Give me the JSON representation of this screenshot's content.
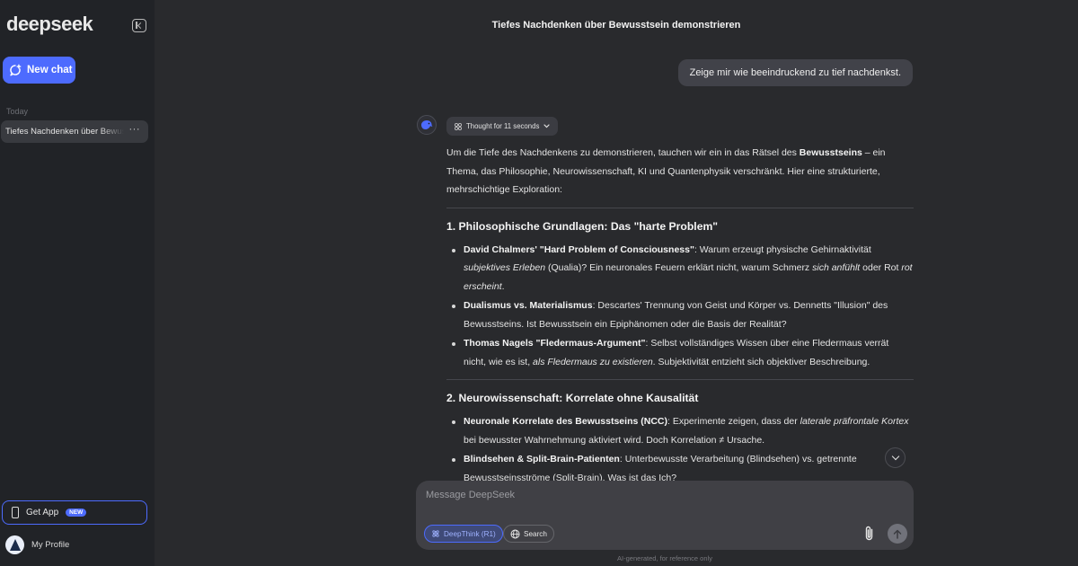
{
  "sidebar": {
    "logo": "deepseek",
    "new_chat_label": "New chat",
    "section_today": "Today",
    "chats": [
      {
        "label": "Tiefes Nachdenken über Bewusstsein demonstrieren"
      }
    ],
    "get_app_label": "Get App",
    "get_app_badge": "NEW",
    "profile_label": "My Profile"
  },
  "header": {
    "title": "Tiefes Nachdenken über Bewusstsein demonstrieren"
  },
  "conversation": {
    "user_message": "Zeige mir wie beeindruckend zu tief nachdenkst.",
    "thought_label": "Thought for 11 seconds",
    "intro": {
      "pre": "Um die Tiefe des Nachdenkens zu demonstrieren, tauchen wir ein in das Rätsel des ",
      "bold": "Bewusstseins",
      "post": " – ein Thema, das Philosophie, Neurowissenschaft, KI und Quantenphysik verschränkt. Hier eine strukturierte, mehrschichtige Exploration:"
    },
    "sections": [
      {
        "heading": "1. Philosophische Grundlagen: Das \"harte Problem\"",
        "items": [
          {
            "bold": "David Chalmers' \"Hard Problem of Consciousness\"",
            "t1": ": Warum erzeugt physische Gehirnaktivität ",
            "i1": "subjektives Erleben",
            "t2": " (Qualia)? Ein neuronales Feuern erklärt nicht, warum Schmerz ",
            "i2": "sich anfühlt",
            "t3": " oder Rot ",
            "i3": "rot erscheint",
            "t4": "."
          },
          {
            "bold": "Dualismus vs. Materialismus",
            "t1": ": Descartes' Trennung von Geist und Körper vs. Dennetts \"Illusion\" des Bewusstseins. Ist Bewusstsein ein Epiphänomen oder die Basis der Realität?"
          },
          {
            "bold": "Thomas Nagels \"Fledermaus-Argument\"",
            "t1": ": Selbst vollständiges Wissen über eine Fledermaus verrät nicht, wie es ist, ",
            "i1": "als Fledermaus zu existieren",
            "t2": ". Subjektivität entzieht sich objektiver Beschreibung."
          }
        ]
      },
      {
        "heading": "2. Neurowissenschaft: Korrelate ohne Kausalität",
        "items": [
          {
            "bold": "Neuronale Korrelate des Bewusstseins (NCC)",
            "t1": ": Experimente zeigen, dass der ",
            "i1": "laterale präfrontale Kortex",
            "t2": " bei bewusster Wahrnehmung aktiviert wird. Doch Korrelation ≠ Ursache."
          },
          {
            "bold": "Blindsehen & Split-Brain-Patienten",
            "t1": ": Unterbewusste Verarbeitung (Blindsehen) vs. getrennte Bewusstseinsströme (Split-Brain). Was ist das Ich?"
          }
        ]
      }
    ]
  },
  "composer": {
    "placeholder": "Message DeepSeek",
    "deepthink_label": "DeepThink (R1)",
    "search_label": "Search",
    "footer_note": "AI-generated, for reference only"
  },
  "colors": {
    "accent": "#4d6bfe",
    "background": "#292a2d",
    "sidebar": "#212327"
  }
}
